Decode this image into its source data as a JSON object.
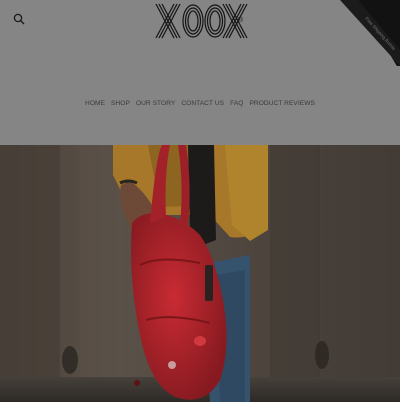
{
  "header": {
    "logo_text": "XOOX",
    "logo_mark": "®",
    "search_icon": "search-icon",
    "cart_icon": "shopping-bag-icon"
  },
  "nav": {
    "items": [
      {
        "label": "HOME"
      },
      {
        "label": "SHOP"
      },
      {
        "label": "OUR STORY"
      },
      {
        "label": "CONTACT US"
      },
      {
        "label": "FAQ"
      },
      {
        "label": "PRODUCT REVIEWS"
      }
    ]
  },
  "ribbon": {
    "label": "Free Shipping Across"
  },
  "colors": {
    "header_bg": "#858585",
    "hero_bg": "#4a433d",
    "bag_red": "#b3202a",
    "jacket_yellow": "#b8862a",
    "jeans_blue": "#3c5a78"
  }
}
